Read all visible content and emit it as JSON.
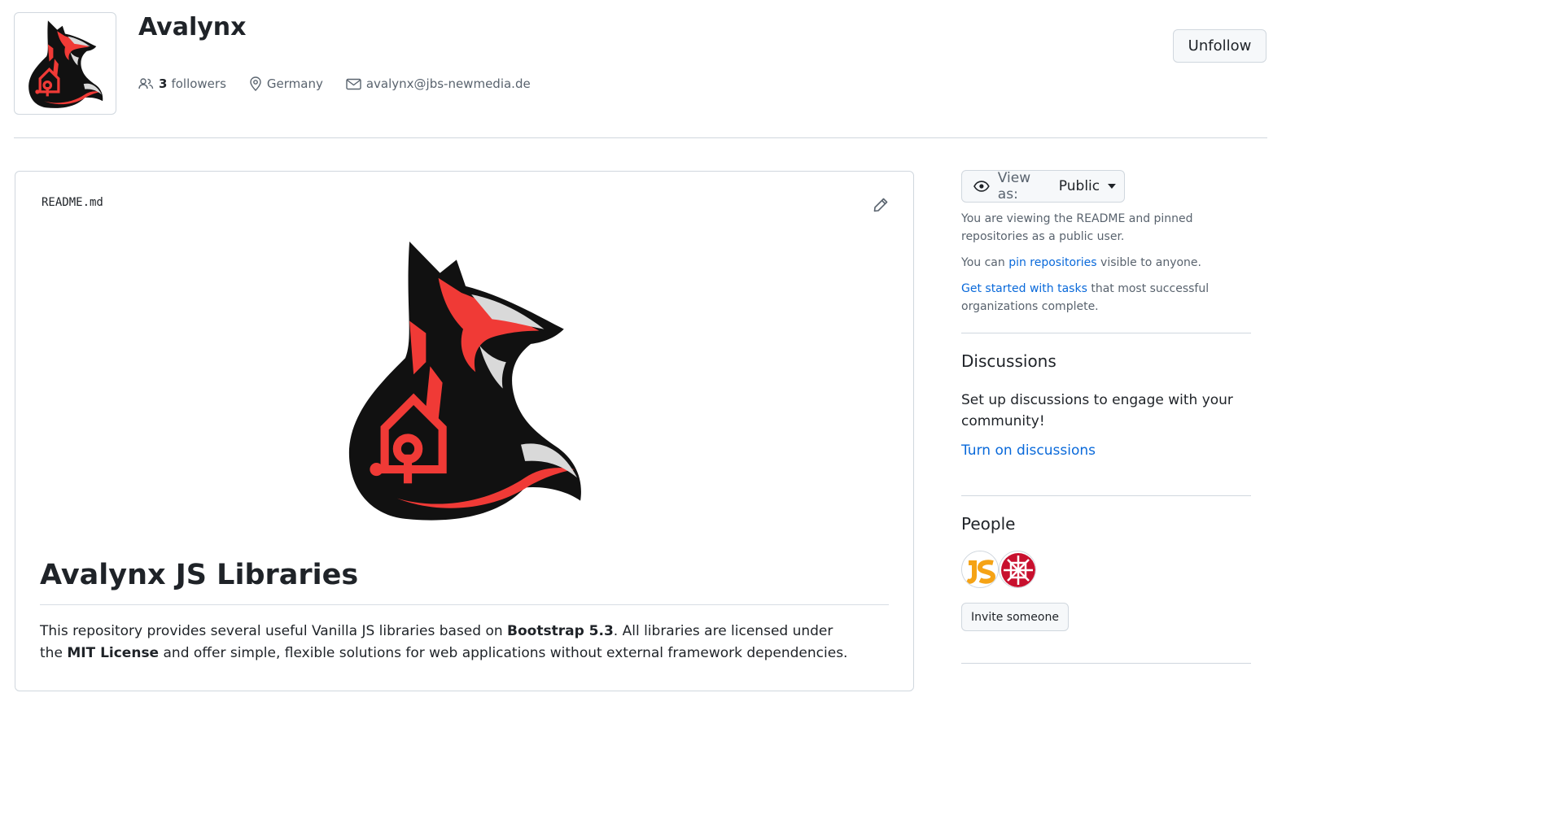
{
  "org": {
    "name": "Avalynx",
    "followers_count": "3",
    "followers_label": "followers",
    "location": "Germany",
    "email": "avalynx@jbs-newmedia.de",
    "unfollow_label": "Unfollow",
    "logo_icon": "fox-logo-icon"
  },
  "readme": {
    "filename": "README.md",
    "title": "Avalynx JS Libraries",
    "desc_part1": "This repository provides several useful Vanilla JS libraries based on ",
    "desc_bold1": "Bootstrap 5.3",
    "desc_part2": ". All libraries are licensed under the ",
    "desc_bold2": "MIT License",
    "desc_part3": " and offer simple, flexible solutions for web applications without external framework dependencies."
  },
  "sidebar": {
    "view_as_label": "View as:",
    "view_as_value": "Public",
    "viewing_text": "You are viewing the README and pinned repositories as a public user.",
    "pin_prefix": "You can ",
    "pin_link": "pin repositories",
    "pin_suffix": " visible to anyone.",
    "tasks_link": "Get started with tasks",
    "tasks_suffix": " that most successful organizations complete.",
    "discussions_heading": "Discussions",
    "discussions_text": "Set up discussions to engage with your community!",
    "discussions_link": "Turn on discussions",
    "people_heading": "People",
    "invite_label": "Invite someone"
  },
  "colors": {
    "accent_link": "#0969da",
    "fox_red": "#f03a36",
    "fox_black": "#111111"
  }
}
